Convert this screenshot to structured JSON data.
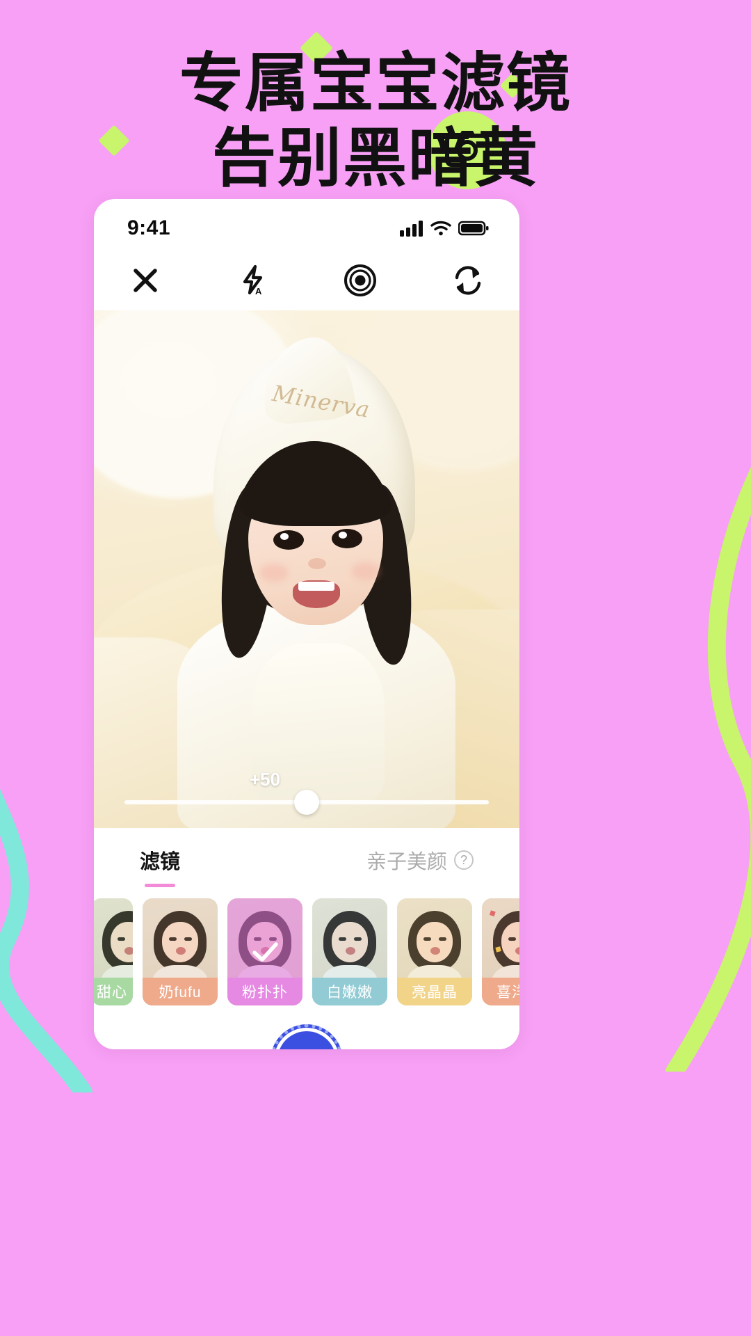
{
  "poster": {
    "background_color": "#F7A0F5",
    "accent_green": "#C8F56B",
    "headline_line1": "专属宝宝滤镜",
    "headline_line2": "告别黑暗黄",
    "badge_icon": "camera-icon"
  },
  "phone": {
    "status_bar": {
      "time": "9:41",
      "icons": [
        "cellular-signal-icon",
        "wifi-icon",
        "battery-icon"
      ]
    },
    "camera_toolbar": [
      {
        "name": "close-icon",
        "label": "关闭"
      },
      {
        "name": "flash-auto-icon",
        "label": "自动闪光"
      },
      {
        "name": "aperture-icon",
        "label": "光圈"
      },
      {
        "name": "flip-camera-icon",
        "label": "翻转"
      }
    ],
    "viewfinder": {
      "hood_brand_text": "Minerva"
    },
    "slider": {
      "value_label": "+50",
      "value": 50,
      "min": -100,
      "max": 100,
      "knob_position_percent": 50
    },
    "tabs": [
      {
        "label": "滤镜",
        "active": true
      },
      {
        "label": "亲子美颜",
        "active": false,
        "help_icon": "question-mark-icon",
        "help_label": "?"
      }
    ],
    "filters": [
      {
        "label": "甜心",
        "cap_color": "#A9D9A3",
        "thumb_tint": "rgba(180,220,170,0.18)",
        "selected": false,
        "partial": true
      },
      {
        "label": "奶fufu",
        "cap_color": "#EFA98B",
        "thumb_tint": "rgba(240,190,160,0.20)",
        "selected": false
      },
      {
        "label": "粉扑扑",
        "cap_color": "#E589E2",
        "thumb_tint": "rgba(226,120,220,0.55)",
        "selected": true
      },
      {
        "label": "白嫩嫩",
        "cap_color": "#92CBD4",
        "thumb_tint": "rgba(170,220,230,0.18)",
        "selected": false
      },
      {
        "label": "亮晶晶",
        "cap_color": "#F2D489",
        "thumb_tint": "rgba(245,220,150,0.22)",
        "selected": false
      },
      {
        "label": "喜洋洋",
        "cap_color": "#EFA98B",
        "thumb_tint": "rgba(240,180,150,0.22)",
        "selected": false,
        "confetti": true
      },
      {
        "label": "",
        "cap_color": "#D8C9A8",
        "thumb_tint": "rgba(180,200,210,0.20)",
        "selected": false,
        "partial": true
      }
    ],
    "shutter": {
      "label": "拍摄",
      "color": "#3B4FE0"
    }
  }
}
